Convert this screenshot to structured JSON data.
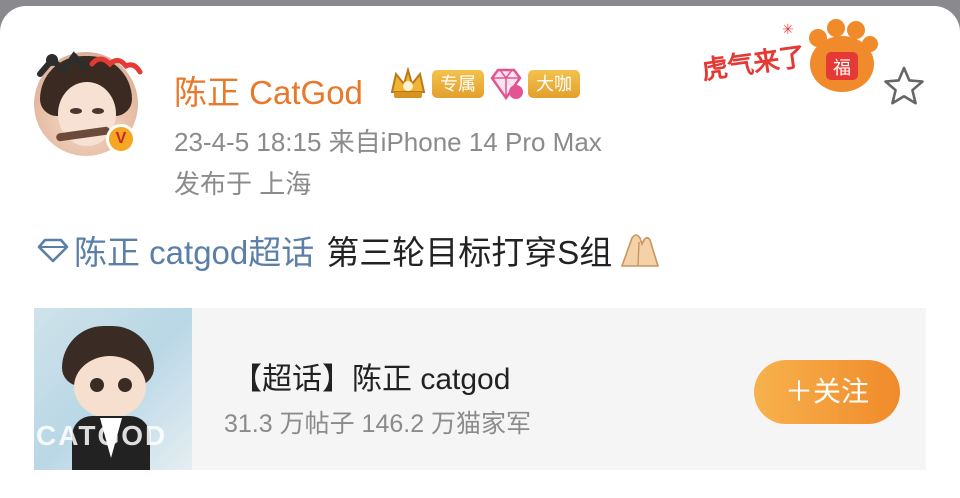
{
  "post": {
    "author": {
      "name": "陈正 CatGod",
      "verified_label": "V",
      "tags": [
        "专属",
        "大咖"
      ]
    },
    "meta": {
      "time_source": "23-4-5 18:15  来自iPhone 14 Pro Max",
      "location": "发布于 上海"
    },
    "topic_link": "陈正 catgod超话",
    "text": "第三轮目标打穿S组"
  },
  "topic_card": {
    "title": "【超话】陈正 catgod",
    "stats": "31.3 万帖子 146.2 万猫家军",
    "cover_text": "CATGOD",
    "follow_label": "＋关注"
  },
  "icons": {
    "favorite": "star-outline-icon",
    "topic": "diamond-icon",
    "emoji": "folded-hands-emoji-icon",
    "crown": "crown-icon",
    "diamond_level": "diamond-level-icon"
  },
  "colors": {
    "name": "#e8792a",
    "topic_link": "#5b7fa8",
    "follow_start": "#f7b24d",
    "follow_end": "#f08a2a",
    "meta": "#8b8b8b"
  }
}
